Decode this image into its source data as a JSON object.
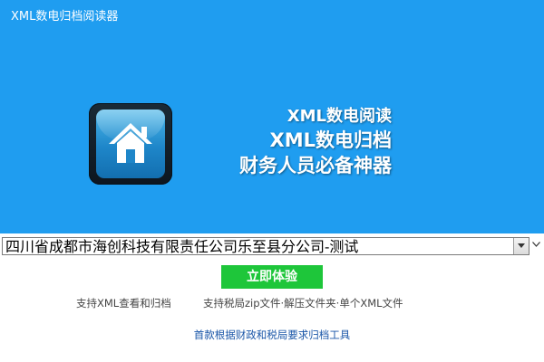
{
  "window": {
    "title": "XML数电归档阅读器"
  },
  "banner": {
    "icon": "home-icon",
    "slogans": [
      "XML数电阅读",
      "XML数电归档",
      "财务人员必备神器"
    ],
    "background_color": "#1f9df0"
  },
  "org_select": {
    "value": "四川省成都市海创科技有限责任公司乐至县分公司-测试"
  },
  "trial_button": {
    "label": "立即体验",
    "color": "#1ec63a"
  },
  "features": [
    "支持XML查看和归档",
    "支持税局zip文件·解压文件夹·单个XML文件"
  ],
  "footer": {
    "text": "首款根据财政和税局要求归档工具"
  }
}
